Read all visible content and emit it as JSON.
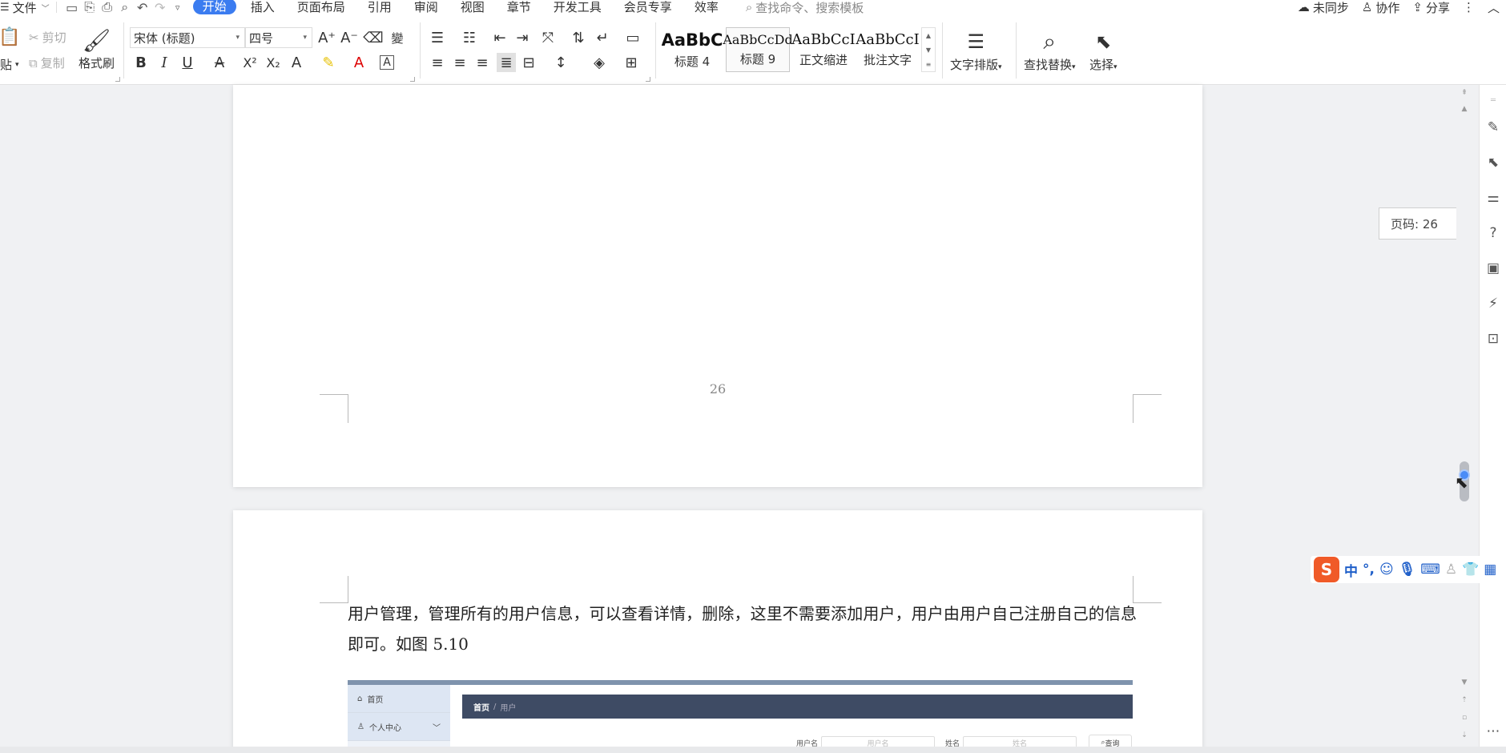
{
  "menubar": {
    "file_label": "文件",
    "tabs": [
      {
        "label": "开始",
        "active": true
      },
      {
        "label": "插入"
      },
      {
        "label": "页面布局"
      },
      {
        "label": "引用"
      },
      {
        "label": "审阅"
      },
      {
        "label": "视图"
      },
      {
        "label": "章节"
      },
      {
        "label": "开发工具"
      },
      {
        "label": "会员专享"
      },
      {
        "label": "效率"
      }
    ],
    "search_placeholder": "查找命令、搜索模板",
    "right": {
      "sync": "未同步",
      "collab": "协作",
      "share": "分享"
    }
  },
  "ribbon": {
    "paste": "贴",
    "cut": "剪切",
    "copy": "复制",
    "format_painter": "格式刷",
    "font_name": "宋体 (标题)",
    "font_size": "四号",
    "styles": [
      {
        "preview": "AaBbC",
        "label": "标题 4"
      },
      {
        "preview": "AaBbCcDd",
        "label": "标题 9"
      },
      {
        "preview": "AaBbCcI",
        "label": "正文缩进"
      },
      {
        "preview": "AaBbCcI",
        "label": "批注文字"
      }
    ],
    "text_layout": "文字排版",
    "find_replace": "查找替换",
    "select": "选择"
  },
  "document": {
    "page_number": "26",
    "paragraph": "用户管理，管理所有的用户信息，可以查看详情，删除，这里不需要添加用户，用户由用户自己注册自己的信息即可。如图 5.10",
    "embedded": {
      "menu_home": "首页",
      "menu_profile": "个人中心",
      "breadcrumb_home": "首页",
      "breadcrumb_sep": "/",
      "breadcrumb_current": "用户",
      "field_username_label": "用户名",
      "field_username_placeholder": "用户名",
      "field_name_label": "姓名",
      "field_name_placeholder": "姓名",
      "search_button": "查询"
    }
  },
  "page_tip": "页码: 26",
  "colors": {
    "accent": "#3b7cf0",
    "ime_logo": "#f05a28"
  }
}
